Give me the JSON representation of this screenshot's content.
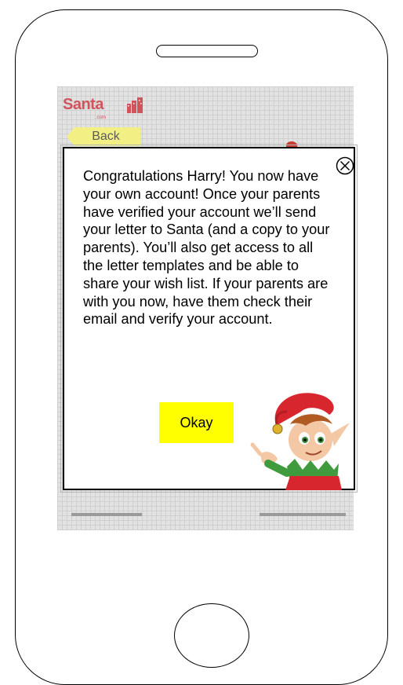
{
  "device": {
    "speaker_icon": "speaker-slot",
    "home_button_icon": "home-button-circle"
  },
  "app": {
    "logo_text": "Santa",
    "logo_subtext": ".com",
    "logo_icon": "buildings-icon",
    "back_label": "Back"
  },
  "dialog": {
    "message": "Congratulations Harry! You now have your own account!  Once your parents have verified your account we’ll send your letter to Santa  (and a copy to your parents). You’ll also get access to all the letter templates and be able to share your wish list.  If your parents are with you now, have them check their email and verify your account.",
    "close_icon": "circle-x-icon",
    "okay_label": "Okay",
    "elf_image": "elf-illustration"
  },
  "colors": {
    "logo": "#d1535b",
    "back_button": "#f2ef85",
    "okay_button": "#ffff00"
  }
}
